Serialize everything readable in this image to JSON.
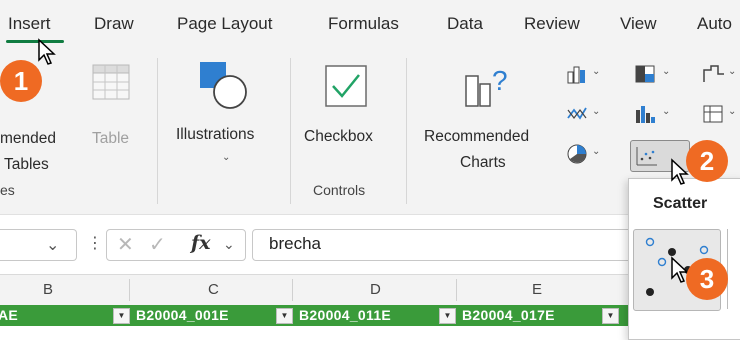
{
  "tabs": [
    {
      "label": "Insert",
      "active": true
    },
    {
      "label": "Draw"
    },
    {
      "label": "Page Layout"
    },
    {
      "label": "Formulas"
    },
    {
      "label": "Data"
    },
    {
      "label": "Review"
    },
    {
      "label": "View"
    },
    {
      "label": "Auto"
    }
  ],
  "ribbon": {
    "recommended_pivot": {
      "line1": "mended",
      "line2": "Tables"
    },
    "table": {
      "label": "Table"
    },
    "illustrations": {
      "label": "Illustrations"
    },
    "checkbox": {
      "label": "Checkbox"
    },
    "recommended_charts": {
      "line1": "Recommended",
      "line2": "Charts"
    },
    "groups": {
      "tables_partial": "es",
      "controls": "Controls"
    }
  },
  "dropdown": {
    "title": "Scatter"
  },
  "formula_bar": {
    "fx": "fx",
    "value": "brecha"
  },
  "columns": [
    "B",
    "C",
    "D",
    "E"
  ],
  "row_cells": [
    "AE",
    "B20004_001E",
    "B20004_011E",
    "B20004_017E"
  ],
  "badges": [
    "1",
    "2",
    "3"
  ],
  "colors": {
    "accent": "#107c41",
    "badge": "#ef6a23",
    "header_row": "#3a9b3a"
  }
}
